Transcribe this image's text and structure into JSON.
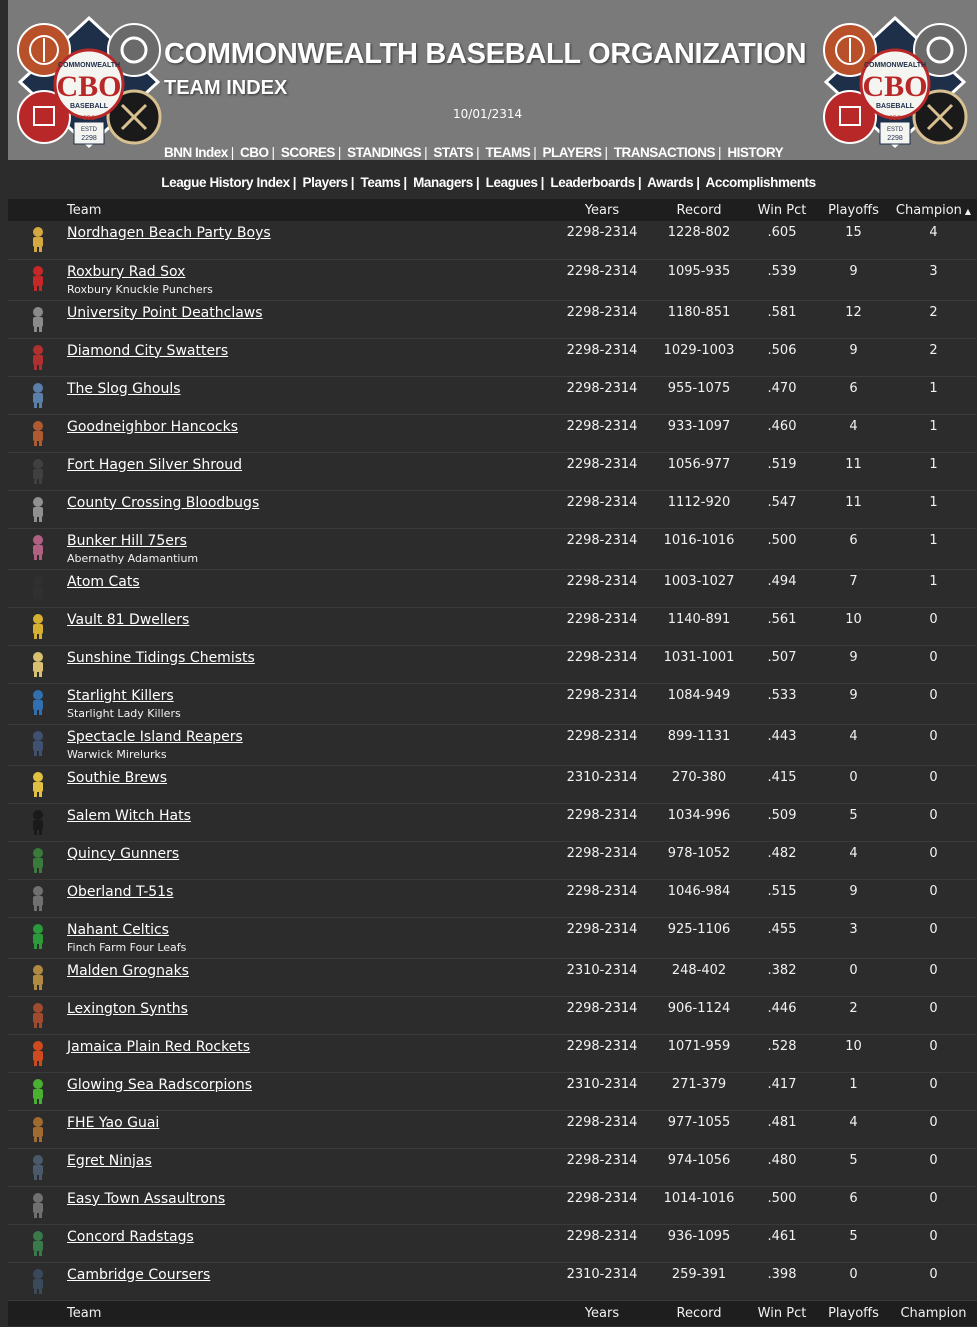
{
  "header": {
    "title": "COMMONWEALTH BASEBALL ORGANIZATION",
    "subtitle": "TEAM INDEX",
    "date": "10/01/2314",
    "logo_lettering": [
      "COMMONWEALTH",
      "CBO",
      "BASEBALL",
      "CBO",
      "ESTD",
      "2298"
    ]
  },
  "topnav": [
    "BNN Index",
    "CBO",
    "SCORES",
    "STANDINGS",
    "STATS",
    "TEAMS",
    "PLAYERS",
    "TRANSACTIONS",
    "HISTORY"
  ],
  "subnav": [
    "League History Index",
    "Players",
    "Teams",
    "Managers",
    "Leagues",
    "Leaderboards",
    "Awards",
    "Accomplishments"
  ],
  "table": {
    "columns": {
      "team": "Team",
      "years": "Years",
      "record": "Record",
      "winpct": "Win Pct",
      "playoffs": "Playoffs",
      "champion": "Champion"
    },
    "rows": [
      {
        "icon": "vault-boy-icon",
        "color": "#d6a840",
        "name": "Nordhagen Beach Party Boys",
        "former": "",
        "years": "2298-2314",
        "record": "1228-802",
        "winpct": ".605",
        "playoffs": "15",
        "champion": "4"
      },
      {
        "icon": "letter-r-icon",
        "color": "#c62828",
        "name": "Roxbury Rad Sox",
        "former": "Roxbury Knuckle Punchers",
        "years": "2298-2314",
        "record": "1095-935",
        "winpct": ".539",
        "playoffs": "9",
        "champion": "3"
      },
      {
        "icon": "deathclaw-icon",
        "color": "#8a8a8a",
        "name": "University Point Deathclaws",
        "former": "",
        "years": "2298-2314",
        "record": "1180-851",
        "winpct": ".581",
        "playoffs": "12",
        "champion": "2"
      },
      {
        "icon": "batter-icon",
        "color": "#b03030",
        "name": "Diamond City Swatters",
        "former": "",
        "years": "2298-2314",
        "record": "1029-1003",
        "winpct": ".506",
        "playoffs": "9",
        "champion": "2"
      },
      {
        "icon": "ghoul-icon",
        "color": "#5a7fa8",
        "name": "The Slog Ghouls",
        "former": "",
        "years": "2298-2314",
        "record": "955-1075",
        "winpct": ".470",
        "playoffs": "6",
        "champion": "1"
      },
      {
        "icon": "hancock-icon",
        "color": "#b05a30",
        "name": "Goodneighbor Hancocks",
        "former": "",
        "years": "2298-2314",
        "record": "933-1097",
        "winpct": ".460",
        "playoffs": "4",
        "champion": "1"
      },
      {
        "icon": "silver-shroud-icon",
        "color": "#404040",
        "name": "Fort Hagen Silver Shroud",
        "former": "",
        "years": "2298-2314",
        "record": "1056-977",
        "winpct": ".519",
        "playoffs": "11",
        "champion": "1"
      },
      {
        "icon": "bloodbug-icon",
        "color": "#909090",
        "name": "County Crossing Bloodbugs",
        "former": "",
        "years": "2298-2314",
        "record": "1112-920",
        "winpct": ".547",
        "playoffs": "11",
        "champion": "1"
      },
      {
        "icon": "seventy-fiver-icon",
        "color": "#b06080",
        "name": "Bunker Hill 75ers",
        "former": "Abernathy Adamantium",
        "years": "2298-2314",
        "record": "1016-1016",
        "winpct": ".500",
        "playoffs": "6",
        "champion": "1"
      },
      {
        "icon": "atom-cat-icon",
        "color": "#303030",
        "name": "Atom Cats",
        "former": "",
        "years": "2298-2314",
        "record": "1003-1027",
        "winpct": ".494",
        "playoffs": "7",
        "champion": "1"
      },
      {
        "icon": "vault-emblem-icon",
        "color": "#d6b030",
        "name": "Vault 81 Dwellers",
        "former": "",
        "years": "2298-2314",
        "record": "1140-891",
        "winpct": ".561",
        "playoffs": "10",
        "champion": "0"
      },
      {
        "icon": "chemist-icon",
        "color": "#d8c070",
        "name": "Sunshine Tidings Chemists",
        "former": "",
        "years": "2298-2314",
        "record": "1031-1001",
        "winpct": ".507",
        "playoffs": "9",
        "champion": "0"
      },
      {
        "icon": "starlight-icon",
        "color": "#3070b0",
        "name": "Starlight Killers",
        "former": "Starlight Lady Killers",
        "years": "2298-2314",
        "record": "1084-949",
        "winpct": ".533",
        "playoffs": "9",
        "champion": "0"
      },
      {
        "icon": "reaper-icon",
        "color": "#405070",
        "name": "Spectacle Island Reapers",
        "former": "Warwick Mirelurks",
        "years": "2298-2314",
        "record": "899-1131",
        "winpct": ".443",
        "playoffs": "4",
        "champion": "0"
      },
      {
        "icon": "brew-icon",
        "color": "#e0c040",
        "name": "Southie Brews",
        "former": "",
        "years": "2310-2314",
        "record": "270-380",
        "winpct": ".415",
        "playoffs": "0",
        "champion": "0"
      },
      {
        "icon": "witch-hat-icon",
        "color": "#1a1a1a",
        "name": "Salem Witch Hats",
        "former": "",
        "years": "2298-2314",
        "record": "1034-996",
        "winpct": ".509",
        "playoffs": "5",
        "champion": "0"
      },
      {
        "icon": "gunner-skull-icon",
        "color": "#3a7a3a",
        "name": "Quincy Gunners",
        "former": "",
        "years": "2298-2314",
        "record": "978-1052",
        "winpct": ".482",
        "playoffs": "4",
        "champion": "0"
      },
      {
        "icon": "power-armor-icon",
        "color": "#707070",
        "name": "Oberland T-51s",
        "former": "",
        "years": "2298-2314",
        "record": "1046-984",
        "winpct": ".515",
        "playoffs": "9",
        "champion": "0"
      },
      {
        "icon": "celtic-icon",
        "color": "#2a9a3a",
        "name": "Nahant Celtics",
        "former": "Finch Farm Four Leafs",
        "years": "2298-2314",
        "record": "925-1106",
        "winpct": ".455",
        "playoffs": "3",
        "champion": "0"
      },
      {
        "icon": "grognak-icon",
        "color": "#b08a40",
        "name": "Malden Grognaks",
        "former": "",
        "years": "2310-2314",
        "record": "248-402",
        "winpct": ".382",
        "playoffs": "0",
        "champion": "0"
      },
      {
        "icon": "synth-icon",
        "color": "#a04a30",
        "name": "Lexington Synths",
        "former": "",
        "years": "2298-2314",
        "record": "906-1124",
        "winpct": ".446",
        "playoffs": "2",
        "champion": "0"
      },
      {
        "icon": "rocket-icon",
        "color": "#d04a20",
        "name": "Jamaica Plain Red Rockets",
        "former": "",
        "years": "2298-2314",
        "record": "1071-959",
        "winpct": ".528",
        "playoffs": "10",
        "champion": "0"
      },
      {
        "icon": "radscorpion-icon",
        "color": "#4ab030",
        "name": "Glowing Sea Radscorpions",
        "former": "",
        "years": "2310-2314",
        "record": "271-379",
        "winpct": ".417",
        "playoffs": "1",
        "champion": "0"
      },
      {
        "icon": "fhe-wordmark-icon",
        "color": "#a06a30",
        "name": "FHE Yao Guai",
        "former": "",
        "years": "2298-2314",
        "record": "977-1055",
        "winpct": ".481",
        "playoffs": "4",
        "champion": "0"
      },
      {
        "icon": "ninja-icon",
        "color": "#4a5a6a",
        "name": "Egret Ninjas",
        "former": "",
        "years": "2298-2314",
        "record": "974-1056",
        "winpct": ".480",
        "playoffs": "5",
        "champion": "0"
      },
      {
        "icon": "assaultron-icon",
        "color": "#707070",
        "name": "Easy Town Assaultrons",
        "former": "",
        "years": "2298-2314",
        "record": "1014-1016",
        "winpct": ".500",
        "playoffs": "6",
        "champion": "0"
      },
      {
        "icon": "radstag-icon",
        "color": "#3a7a4a",
        "name": "Concord Radstags",
        "former": "",
        "years": "2298-2314",
        "record": "936-1095",
        "winpct": ".461",
        "playoffs": "5",
        "champion": "0"
      },
      {
        "icon": "courser-icon",
        "color": "#3a4a5a",
        "name": "Cambridge Coursers",
        "former": "",
        "years": "2310-2314",
        "record": "259-391",
        "winpct": ".398",
        "playoffs": "0",
        "champion": "0"
      }
    ]
  }
}
